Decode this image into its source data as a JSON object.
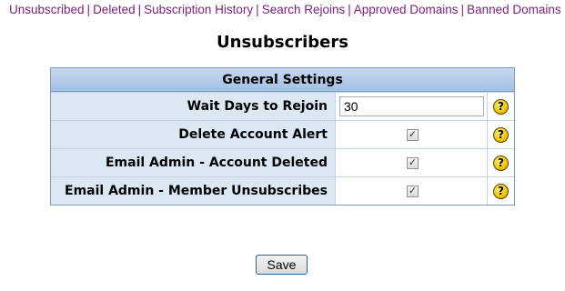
{
  "nav": {
    "links": [
      "Unsubscribed",
      "Deleted",
      "Subscription History",
      "Search Rejoins",
      "Approved Domains",
      "Banned Domains"
    ],
    "separator": "|"
  },
  "page": {
    "title": "Unsubscribers"
  },
  "settings": {
    "heading": "General Settings",
    "rows": [
      {
        "label": "Wait Days to Rejoin",
        "type": "text",
        "value": "30",
        "help_icon": "question-icon"
      },
      {
        "label": "Delete Account Alert",
        "type": "checkbox",
        "checked": true,
        "help_icon": "question-icon"
      },
      {
        "label": "Email Admin - Account Deleted",
        "type": "checkbox",
        "checked": true,
        "help_icon": "question-icon"
      },
      {
        "label": "Email Admin - Member Unsubscribes",
        "type": "checkbox",
        "checked": true,
        "help_icon": "question-icon"
      }
    ]
  },
  "actions": {
    "save_label": "Save"
  },
  "colors": {
    "link": "#7a1f7a",
    "header_bg": "#a3c0e4",
    "label_bg": "#dce7f4",
    "help_icon": "#f2c200"
  }
}
